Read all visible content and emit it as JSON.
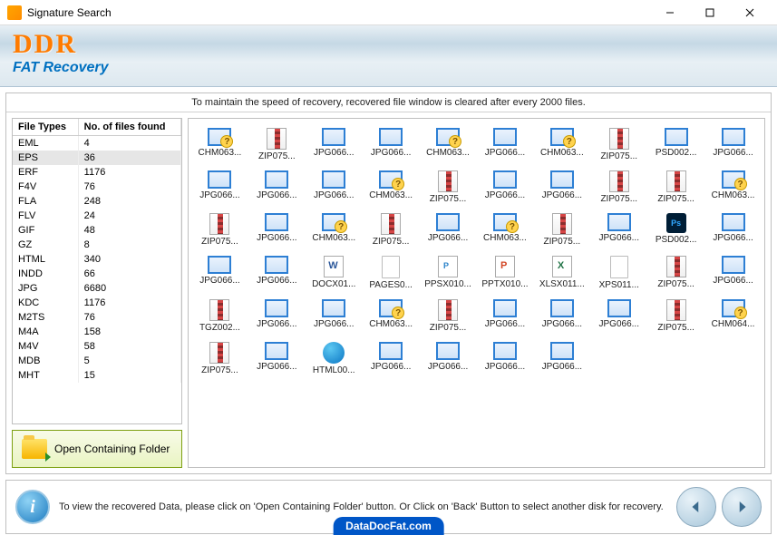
{
  "window": {
    "title": "Signature Search"
  },
  "brand": {
    "main": "DDR",
    "sub": "FAT Recovery"
  },
  "info_strip": "To maintain the speed of recovery, recovered file window is cleared after every 2000 files.",
  "table": {
    "headers": {
      "col1": "File Types",
      "col2": "No. of files found"
    },
    "rows": [
      {
        "type": "EML",
        "count": "4"
      },
      {
        "type": "EPS",
        "count": "36",
        "selected": true
      },
      {
        "type": "ERF",
        "count": "1176"
      },
      {
        "type": "F4V",
        "count": "76"
      },
      {
        "type": "FLA",
        "count": "248"
      },
      {
        "type": "FLV",
        "count": "24"
      },
      {
        "type": "GIF",
        "count": "48"
      },
      {
        "type": "GZ",
        "count": "8"
      },
      {
        "type": "HTML",
        "count": "340"
      },
      {
        "type": "INDD",
        "count": "66"
      },
      {
        "type": "JPG",
        "count": "6680"
      },
      {
        "type": "KDC",
        "count": "1176"
      },
      {
        "type": "M2TS",
        "count": "76"
      },
      {
        "type": "M4A",
        "count": "158"
      },
      {
        "type": "M4V",
        "count": "58"
      },
      {
        "type": "MDB",
        "count": "5"
      },
      {
        "type": "MHT",
        "count": "15"
      }
    ]
  },
  "open_button": "Open Containing Folder",
  "files": [
    {
      "name": "CHM063...",
      "icon": "q"
    },
    {
      "name": "ZIP075...",
      "icon": "zip"
    },
    {
      "name": "JPG066...",
      "icon": "img"
    },
    {
      "name": "JPG066...",
      "icon": "img"
    },
    {
      "name": "CHM063...",
      "icon": "q"
    },
    {
      "name": "JPG066...",
      "icon": "img"
    },
    {
      "name": "CHM063...",
      "icon": "q"
    },
    {
      "name": "ZIP075...",
      "icon": "zip"
    },
    {
      "name": "PSD002...",
      "icon": "img"
    },
    {
      "name": "JPG066...",
      "icon": "img"
    },
    {
      "name": "JPG066...",
      "icon": "img"
    },
    {
      "name": "JPG066...",
      "icon": "img"
    },
    {
      "name": "JPG066...",
      "icon": "img"
    },
    {
      "name": "CHM063...",
      "icon": "q"
    },
    {
      "name": "ZIP075...",
      "icon": "zip"
    },
    {
      "name": "JPG066...",
      "icon": "img"
    },
    {
      "name": "JPG066...",
      "icon": "img"
    },
    {
      "name": "ZIP075...",
      "icon": "zip"
    },
    {
      "name": "ZIP075...",
      "icon": "zip"
    },
    {
      "name": "CHM063...",
      "icon": "q"
    },
    {
      "name": "ZIP075...",
      "icon": "zip"
    },
    {
      "name": "JPG066...",
      "icon": "img"
    },
    {
      "name": "CHM063...",
      "icon": "q"
    },
    {
      "name": "ZIP075...",
      "icon": "zip"
    },
    {
      "name": "JPG066...",
      "icon": "img"
    },
    {
      "name": "CHM063...",
      "icon": "q"
    },
    {
      "name": "ZIP075...",
      "icon": "zip"
    },
    {
      "name": "JPG066...",
      "icon": "img"
    },
    {
      "name": "PSD002...",
      "icon": "psd"
    },
    {
      "name": "JPG066...",
      "icon": "img"
    },
    {
      "name": "JPG066...",
      "icon": "img"
    },
    {
      "name": "JPG066...",
      "icon": "img"
    },
    {
      "name": "DOCX01...",
      "icon": "docx"
    },
    {
      "name": "PAGES0...",
      "icon": "blank"
    },
    {
      "name": "PPSX010...",
      "icon": "ppsx"
    },
    {
      "name": "PPTX010...",
      "icon": "pptx"
    },
    {
      "name": "XLSX011...",
      "icon": "xlsx"
    },
    {
      "name": "XPS011...",
      "icon": "blank"
    },
    {
      "name": "ZIP075...",
      "icon": "zip"
    },
    {
      "name": "JPG066...",
      "icon": "img"
    },
    {
      "name": "TGZ002...",
      "icon": "zip"
    },
    {
      "name": "JPG066...",
      "icon": "img"
    },
    {
      "name": "JPG066...",
      "icon": "img"
    },
    {
      "name": "CHM063...",
      "icon": "q"
    },
    {
      "name": "ZIP075...",
      "icon": "zip"
    },
    {
      "name": "JPG066...",
      "icon": "img"
    },
    {
      "name": "JPG066...",
      "icon": "img"
    },
    {
      "name": "JPG066...",
      "icon": "img"
    },
    {
      "name": "ZIP075...",
      "icon": "zip"
    },
    {
      "name": "CHM064...",
      "icon": "q"
    },
    {
      "name": "ZIP075...",
      "icon": "zip"
    },
    {
      "name": "JPG066...",
      "icon": "img"
    },
    {
      "name": "HTML00...",
      "icon": "html"
    },
    {
      "name": "JPG066...",
      "icon": "img"
    },
    {
      "name": "JPG066...",
      "icon": "img"
    },
    {
      "name": "JPG066...",
      "icon": "img"
    },
    {
      "name": "JPG066...",
      "icon": "img"
    }
  ],
  "footer": {
    "text": "To view the recovered Data, please click on 'Open Containing Folder' button. Or Click on 'Back' Button to select another disk for recovery.",
    "badge": "DataDocFat.com"
  }
}
